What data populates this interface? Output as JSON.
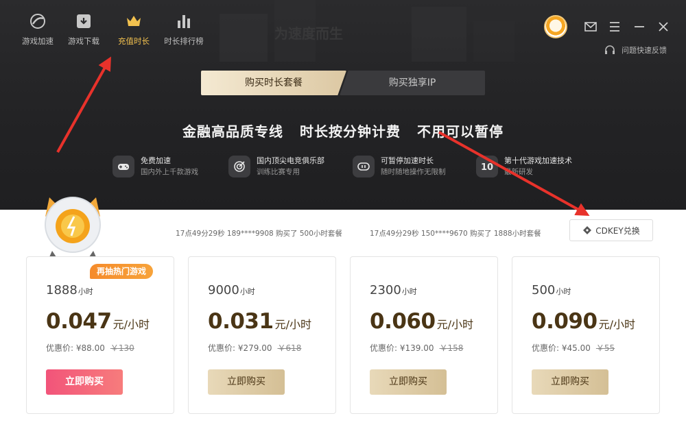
{
  "nav": [
    {
      "label": "游戏加速",
      "icon": "rocket-icon"
    },
    {
      "label": "游戏下载",
      "icon": "download-icon"
    },
    {
      "label": "充值时长",
      "icon": "crown-icon",
      "active": true
    },
    {
      "label": "时长排行榜",
      "icon": "bar-chart-icon"
    }
  ],
  "header": {
    "feedback_label": "问题快速反馈",
    "bg_text": "为速度而生"
  },
  "tabs": [
    {
      "label": "购买时长套餐",
      "active": true
    },
    {
      "label": "购买独享IP",
      "active": false
    }
  ],
  "slogan": [
    "金融高品质专线",
    "时长按分钟计费",
    "不用可以暂停"
  ],
  "features": [
    {
      "title": "免费加速",
      "subtitle": "国内外上千款游戏",
      "icon": "gamepad-icon"
    },
    {
      "title": "国内顶尖电竞俱乐部",
      "subtitle": "训练比赛专用",
      "icon": "target-icon"
    },
    {
      "title": "可暂停加速时长",
      "subtitle": "随时随地操作无限制",
      "icon": "pause-icon"
    },
    {
      "title": "第十代游戏加速技术",
      "subtitle": "最新研发",
      "icon": "tech-10-icon"
    }
  ],
  "tickers": [
    "17点49分29秒  189****9908  购买了  500小时套餐",
    "17点49分29秒  150****9670  购买了  1888小时套餐"
  ],
  "cdkey_label": "CDKEY兑换",
  "cards": [
    {
      "badge": "再抽热门游戏",
      "hours": "1888",
      "hours_unit": "小时",
      "price": "0.047",
      "price_unit": "元/小时",
      "deal_label": "优惠价: ",
      "deal_price": "¥88.00",
      "orig_price": "￥130",
      "buy_label": "立即购买",
      "hot": true
    },
    {
      "hours": "9000",
      "hours_unit": "小时",
      "price": "0.031",
      "price_unit": "元/小时",
      "deal_label": "优惠价: ",
      "deal_price": "¥279.00",
      "orig_price": "￥618",
      "buy_label": "立即购买"
    },
    {
      "hours": "2300",
      "hours_unit": "小时",
      "price": "0.060",
      "price_unit": "元/小时",
      "deal_label": "优惠价: ",
      "deal_price": "¥139.00",
      "orig_price": "￥158",
      "buy_label": "立即购买"
    },
    {
      "hours": "500",
      "hours_unit": "小时",
      "price": "0.090",
      "price_unit": "元/小时",
      "deal_label": "优惠价: ",
      "deal_price": "¥45.00",
      "orig_price": "￥55",
      "buy_label": "立即购买"
    }
  ],
  "colors": {
    "accent_gold": "#f2c14f",
    "hot_button": "#f2547a",
    "price_text": "#4a3515",
    "arrow_red": "#e8322b"
  }
}
